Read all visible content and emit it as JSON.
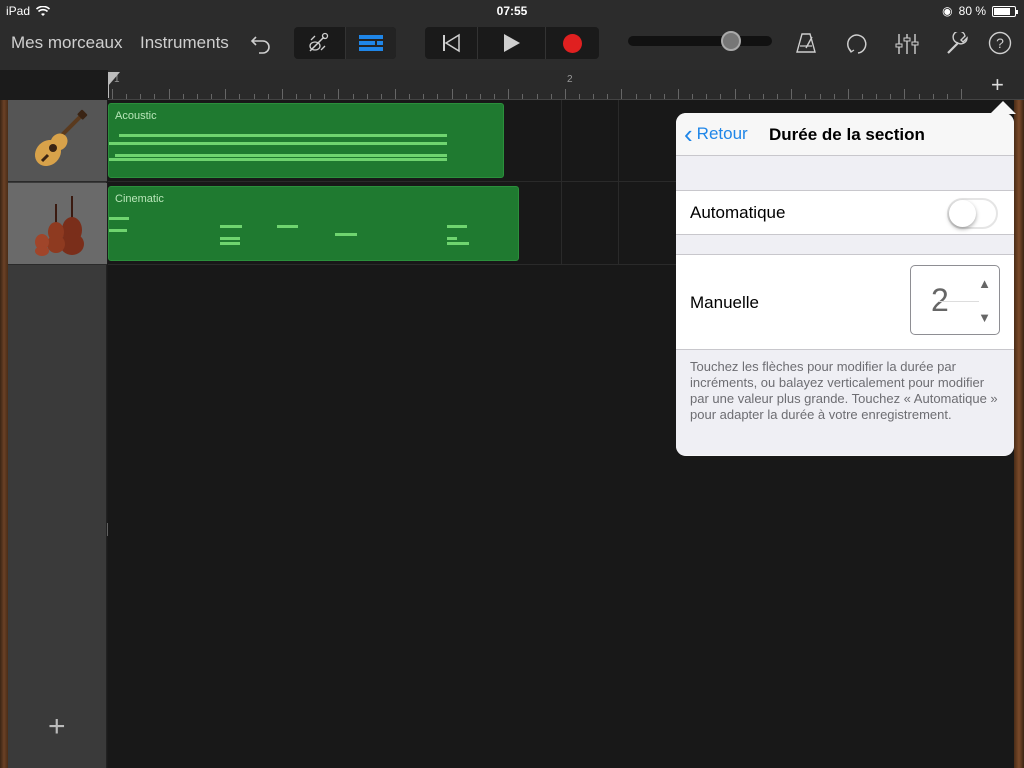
{
  "status": {
    "device": "iPad",
    "time": "07:55",
    "battery": "80 %",
    "battery_level": 0.8
  },
  "toolbar": {
    "my_songs": "Mes morceaux",
    "instruments": "Instruments",
    "undo_icon": "undo-arrow-icon",
    "volume_level": 0.75
  },
  "ruler": {
    "bar1": "1",
    "bar2": "2"
  },
  "tracks": [
    {
      "name": "acoustic-guitar",
      "icon": "guitar-icon"
    },
    {
      "name": "cinematic-strings",
      "icon": "strings-icon"
    }
  ],
  "regions": [
    {
      "name": "Acoustic"
    },
    {
      "name": "Cinematic"
    }
  ],
  "popover": {
    "back": "Retour",
    "title": "Durée de la section",
    "automatic_label": "Automatique",
    "automatic_on": false,
    "manual_label": "Manuelle",
    "manual_value": "2",
    "help_text": "Touchez les flèches pour modifier la durée par incréments, ou balayez verticalement pour modifier par une valeur plus grande. Touchez « Automatique » pour adapter la durée à votre enregistrement."
  }
}
